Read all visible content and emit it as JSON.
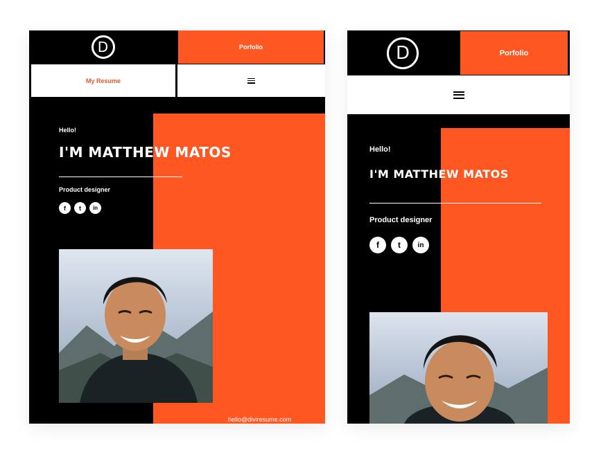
{
  "brand": {
    "logo_letter": "D"
  },
  "nav": {
    "portfolio_label": "Porfolio",
    "resume_label": "My Resume",
    "menu_icon": "hamburger-menu-icon"
  },
  "hero": {
    "greeting": "Hello!",
    "name": "I'M MATTHEW MATOS",
    "role": "Product designer",
    "email": "hello@diviresume.com"
  },
  "socials": [
    {
      "icon": "facebook-icon",
      "glyph": "f"
    },
    {
      "icon": "twitter-icon",
      "glyph": "t"
    },
    {
      "icon": "linkedin-icon",
      "glyph": "in"
    }
  ],
  "colors": {
    "accent": "#ff5722",
    "dark": "#000000",
    "light": "#ffffff",
    "link": "#e4572e"
  },
  "photo": {
    "subject": "smiling man portrait"
  }
}
